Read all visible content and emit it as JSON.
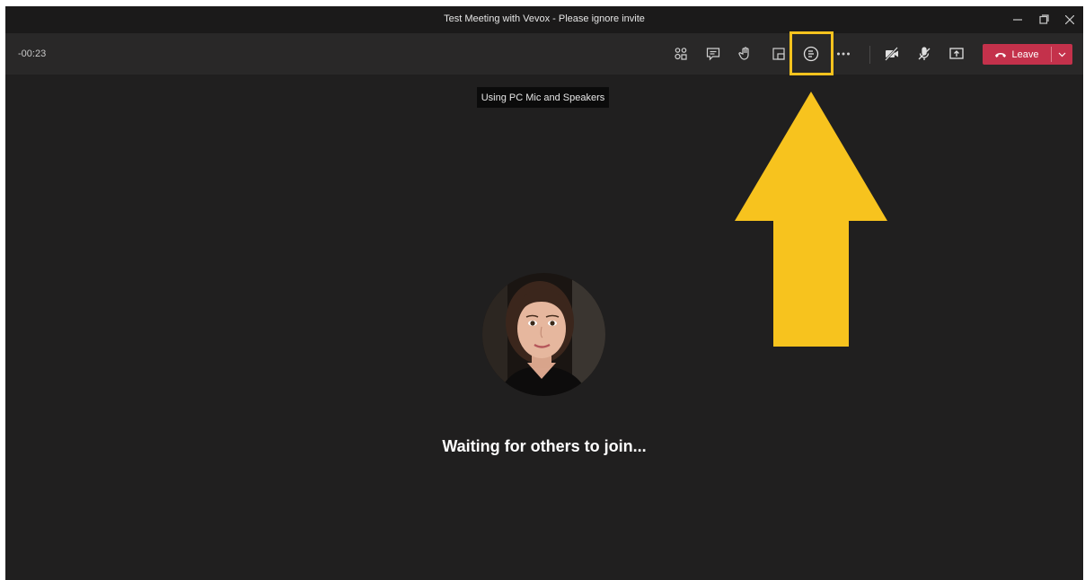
{
  "window": {
    "title": "Test Meeting with Vevox - Please ignore invite",
    "controls": {
      "minimize_icon": "minimize-icon",
      "restore_icon": "restore-icon",
      "close_icon": "close-icon"
    }
  },
  "toolbar": {
    "timer": "-00:23",
    "buttons": [
      "participants-icon",
      "chat-icon",
      "raise-hand-icon",
      "breakout-rooms-icon",
      "meeting-notes-icon",
      "more-options-icon",
      "camera-off-icon",
      "mic-off-icon",
      "share-screen-icon"
    ],
    "leave_label": "Leave",
    "leave_color": "#c4314b"
  },
  "tooltip": "Using PC Mic and Speakers",
  "status": "Waiting for others to join...",
  "annotation": {
    "color": "#f7c31e"
  }
}
